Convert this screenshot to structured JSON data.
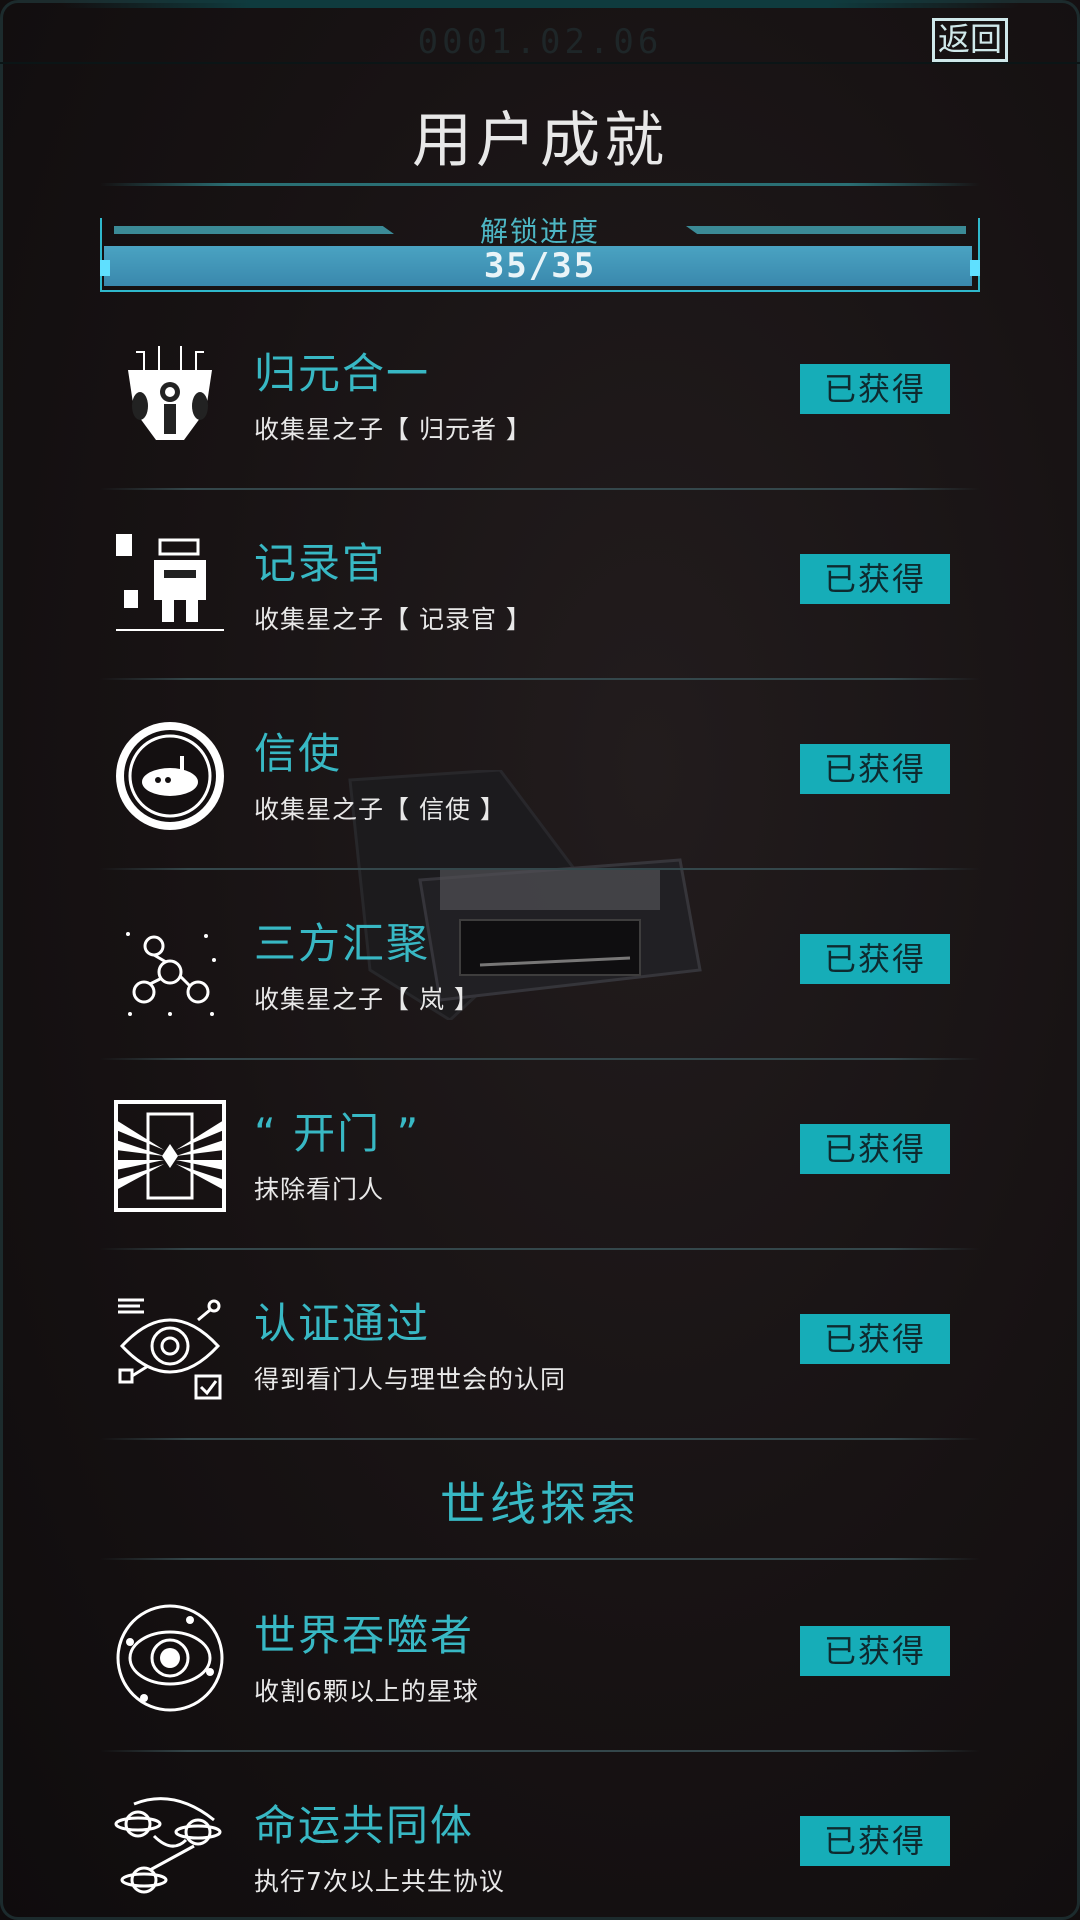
{
  "header": {
    "date": "0001.02.06",
    "back_label": "返回",
    "title": "用户成就"
  },
  "progress": {
    "label": "解锁进度",
    "value_text": "35/35",
    "unlocked": 35,
    "total": 35
  },
  "achievements": [
    {
      "name": "归元合一",
      "desc": "收集星之子【 归元者 】",
      "status": "已获得",
      "icon": "robot-mask-icon"
    },
    {
      "name": "记录官",
      "desc": "收集星之子【 记录官 】",
      "status": "已获得",
      "icon": "recorder-robot-icon"
    },
    {
      "name": "信使",
      "desc": "收集星之子【 信使 】",
      "status": "已获得",
      "icon": "messenger-ship-icon"
    },
    {
      "name": "三方汇聚",
      "desc": "收集星之子【 岚 】",
      "status": "已获得",
      "icon": "network-people-icon"
    },
    {
      "name": "“ 开门 ”",
      "desc": "抹除看门人",
      "status": "已获得",
      "icon": "door-rays-icon"
    },
    {
      "name": "认证通过",
      "desc": "得到看门人与理世会的认同",
      "status": "已获得",
      "icon": "eye-verify-icon"
    }
  ],
  "section": {
    "title": "世线探索"
  },
  "explore": [
    {
      "name": "世界吞噬者",
      "desc": "收割6颗以上的星球",
      "status": "已获得",
      "icon": "orbit-planet-icon"
    },
    {
      "name": "命运共同体",
      "desc": "执行7次以上共生协议",
      "status": "已获得",
      "icon": "planets-link-icon"
    }
  ],
  "colors": {
    "accent": "#38b8c4",
    "badge": "#16adb8",
    "background": "#171213"
  }
}
